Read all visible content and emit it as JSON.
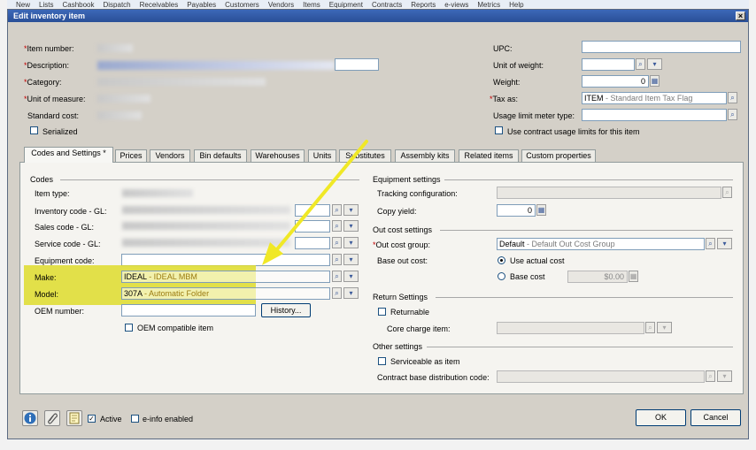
{
  "menu": [
    "New",
    "Lists",
    "Cashbook",
    "Dispatch",
    "Receivables",
    "Payables",
    "Customers",
    "Vendors",
    "Items",
    "Equipment",
    "Contracts",
    "Reports",
    "e-views",
    "Metrics",
    "Help"
  ],
  "window": {
    "title": "Edit inventory item",
    "close": "×"
  },
  "left_fields": {
    "item_number": "Item number:",
    "description": "Description:",
    "category": "Category:",
    "unit_of_measure": "Unit of measure:",
    "standard_cost": "Standard cost:",
    "serialized": "Serialized",
    "required_mark": "*"
  },
  "right_fields": {
    "upc_label": "UPC:",
    "unit_of_weight_label": "Unit of weight:",
    "weight_label": "Weight:",
    "weight_value": "0",
    "tax_as_label": "Tax as:",
    "tax_as_code": "ITEM",
    "tax_as_desc": " - Standard Item Tax Flag",
    "usage_limit_label": "Usage limit meter type:",
    "use_contract_usage": "Use contract usage limits for this item"
  },
  "tabs": [
    "Codes and Settings *",
    "Prices",
    "Vendors",
    "Bin defaults",
    "Warehouses",
    "Units",
    "Substitutes",
    "Assembly kits",
    "Related items",
    "Custom properties"
  ],
  "codes": {
    "section": "Codes",
    "item_type": "Item type:",
    "inventory_code": "Inventory code - GL:",
    "sales_code": "Sales code - GL:",
    "service_code": "Service code - GL:",
    "equipment_code": "Equipment code:",
    "make_label": "Make:",
    "make_code": "IDEAL",
    "make_desc": " - IDEAL MBM",
    "model_label": "Model:",
    "model_code": "307A",
    "model_desc": " - Automatic Folder",
    "oem_number": "OEM number:",
    "history_button": "History...",
    "oem_compatible": "OEM compatible item"
  },
  "equipment_settings": {
    "section": "Equipment settings",
    "tracking_config": "Tracking configuration:",
    "copy_yield": "Copy yield:",
    "copy_yield_value": "0"
  },
  "out_cost": {
    "section": "Out cost settings",
    "group_label": "Out cost group:",
    "group_code": "Default",
    "group_desc": " - Default Out Cost Group",
    "base_label": "Base out cost:",
    "use_actual": "Use actual cost",
    "base_cost": "Base cost",
    "base_cost_value": "$0.00"
  },
  "return_settings": {
    "section": "Return Settings",
    "returnable": "Returnable",
    "core_charge": "Core charge item:"
  },
  "other_settings": {
    "section": "Other settings",
    "serviceable": "Serviceable as item",
    "contract_base": "Contract base distribution code:"
  },
  "footer": {
    "active": "Active",
    "einfo": "e-info enabled",
    "ok": "OK",
    "cancel": "Cancel",
    "check": "✓"
  },
  "colors": {
    "title_bar": "#2a4f97",
    "highlight": "#dedc2b",
    "required": "#c00000"
  }
}
